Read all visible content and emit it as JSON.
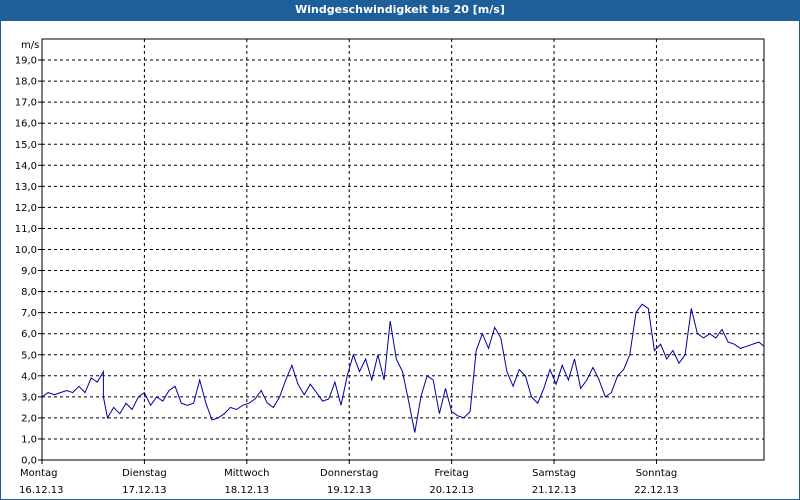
{
  "window": {
    "title": "Windgeschwindigkeit bis 20 [m/s]"
  },
  "colors": {
    "titlebar": "#1f5f99",
    "series": "#0000a0",
    "grid": "#000000",
    "frame": "#1f5f99"
  },
  "chart_data": {
    "type": "line",
    "title": "Windgeschwindigkeit bis 20 [m/s]",
    "ylabel": "m/s",
    "ylim": [
      0,
      20
    ],
    "grid": true,
    "y_ticks": [
      "0,0",
      "1,0",
      "2,0",
      "3,0",
      "4,0",
      "5,0",
      "6,0",
      "7,0",
      "8,0",
      "9,0",
      "10,0",
      "11,0",
      "12,0",
      "13,0",
      "14,0",
      "15,0",
      "16,0",
      "17,0",
      "18,0",
      "19,0"
    ],
    "days": [
      {
        "name": "Montag",
        "date": "16.12.13"
      },
      {
        "name": "Dienstag",
        "date": "17.12.13"
      },
      {
        "name": "Mittwoch",
        "date": "18.12.13"
      },
      {
        "name": "Donnerstag",
        "date": "19.12.13"
      },
      {
        "name": "Freitag",
        "date": "20.12.13"
      },
      {
        "name": "Samstag",
        "date": "21.12.13"
      },
      {
        "name": "Sonntag",
        "date": "22.12.13"
      }
    ],
    "x_range_days": [
      0,
      7.05
    ],
    "series": [
      {
        "x": [
          0,
          0.06,
          0.12,
          0.18,
          0.24,
          0.3,
          0.36,
          0.42,
          0.48,
          0.54,
          0.6,
          0.6,
          0.64,
          0.7,
          0.76,
          0.82,
          0.88,
          0.94,
          1.0,
          1.06,
          1.12,
          1.18,
          1.24,
          1.3,
          1.36,
          1.42,
          1.48,
          1.54,
          1.6,
          1.66,
          1.72,
          1.78,
          1.84,
          1.9,
          1.96,
          2.02,
          2.08,
          2.14,
          2.2,
          2.26,
          2.32,
          2.38,
          2.44,
          2.5,
          2.56,
          2.62,
          2.68,
          2.74,
          2.8,
          2.86,
          2.92,
          2.98,
          3.04,
          3.1,
          3.16,
          3.22,
          3.28,
          3.34,
          3.4,
          3.46,
          3.52,
          3.58,
          3.64,
          3.7,
          3.76,
          3.82,
          3.88,
          3.94,
          4.0,
          4.06,
          4.12,
          4.18,
          4.24,
          4.3,
          4.36,
          4.42,
          4.48,
          4.54,
          4.6,
          4.66,
          4.72,
          4.78,
          4.84,
          4.9,
          4.96,
          5.02,
          5.08,
          5.14,
          5.2,
          5.26,
          5.32,
          5.38,
          5.44,
          5.5,
          5.56,
          5.62,
          5.68,
          5.74,
          5.8,
          5.86,
          5.92,
          5.98,
          6.04,
          6.1,
          6.16,
          6.22,
          6.28,
          6.34,
          6.4,
          6.46,
          6.52,
          6.58,
          6.64,
          6.7,
          6.76,
          6.82,
          6.88,
          6.94,
          7.0,
          7.05
        ],
        "y": [
          3.0,
          3.2,
          3.1,
          3.2,
          3.3,
          3.2,
          3.5,
          3.2,
          3.9,
          3.7,
          4.2,
          3.0,
          2.0,
          2.5,
          2.2,
          2.7,
          2.4,
          3.0,
          3.2,
          2.6,
          3.0,
          2.8,
          3.3,
          3.5,
          2.7,
          2.6,
          2.7,
          3.8,
          2.7,
          1.9,
          2.0,
          2.2,
          2.5,
          2.4,
          2.6,
          2.7,
          2.9,
          3.3,
          2.7,
          2.5,
          3.0,
          3.8,
          4.5,
          3.6,
          3.1,
          3.6,
          3.2,
          2.8,
          2.9,
          3.7,
          2.6,
          4.0,
          5.0,
          4.2,
          4.8,
          3.8,
          5.0,
          3.8,
          6.6,
          4.8,
          4.2,
          2.8,
          1.3,
          3.0,
          4.0,
          3.8,
          2.2,
          3.4,
          2.3,
          2.1,
          2.0,
          2.3,
          5.2,
          6.0,
          5.3,
          6.3,
          5.8,
          4.2,
          3.5,
          4.3,
          4.0,
          3.0,
          2.7,
          3.4,
          4.3,
          3.6,
          4.5,
          3.8,
          4.8,
          3.4,
          3.8,
          4.4,
          3.8,
          3.0,
          3.2,
          4.0,
          4.3,
          5.0,
          7.0,
          7.4,
          7.2,
          5.2,
          5.5,
          4.8,
          5.2,
          4.6,
          5.0,
          7.2,
          6.0,
          5.8,
          6.0,
          5.8,
          6.2,
          5.6,
          5.5,
          5.3,
          5.4,
          5.5,
          5.6,
          5.4
        ]
      }
    ]
  }
}
